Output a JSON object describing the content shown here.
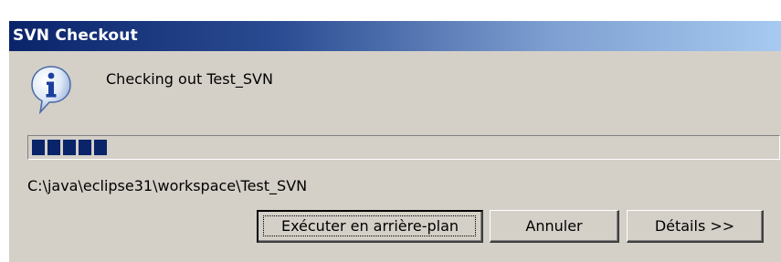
{
  "window": {
    "title": "SVN Checkout"
  },
  "dialog": {
    "message": "Checking out Test_SVN",
    "progress": {
      "segments_filled": 5,
      "color": "#0a246a"
    },
    "path": "C:\\java\\eclipse31\\workspace\\Test_SVN",
    "icon": "info-icon"
  },
  "buttons": {
    "run_in_background": "Exécuter en arrière-plan",
    "cancel": "Annuler",
    "details": "Détails >>"
  }
}
